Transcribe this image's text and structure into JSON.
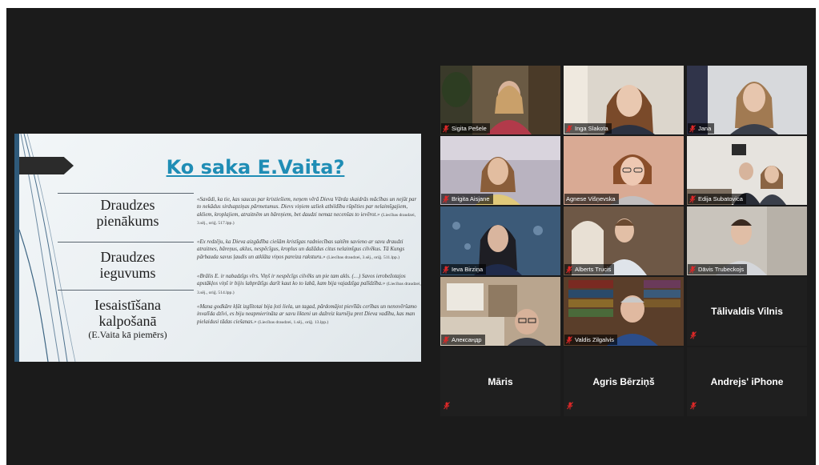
{
  "slide": {
    "title": "Ko saka E.Vaita?",
    "terms": [
      {
        "line1": "Draudzes",
        "line2": "pienākums"
      },
      {
        "line1": "Draudzes",
        "line2": "ieguvums"
      },
      {
        "line1": "Iesaistīšana",
        "line2": "kalpošanā",
        "note": "(E.Vaita kā piemērs)"
      }
    ],
    "quotes": [
      {
        "text": "«Savādi, ka tie, kas saucas par kristiešiem, neņem vērā Dieva Vārda skaidrās mācības un nejūt par to nekādus sirdsapziņas pārmetumus. Dievs viņiem uzliek atbildību rūpēties par nelaimīgajiem, akliem, kroplajiem, atraitnēm un bāreņiem, bet daudzi nemaz necenšas to ievērot.»",
        "source": "(Liecības draudzei, 3.sēj., oriģ. 517.lpp.)"
      },
      {
        "text": "«Ex redzēju, ka Dieva aizgādība ciešām kristīgas radniecības saitēm savieno ar savu draudzi atraitnes, bāreņus, aklus, nespēcīgus, kroplus un dažādus citus nelaimīgus cilvēkus. Tā Kungs pārbauda savus ļaudis un atklāta viņos pareiza raksturu.»",
        "source": "(Liecības draudzei, 3.sēj., oriģ. 511.lpp.)"
      },
      {
        "text": "«Brālis E. ir nabadzīgs vīrs. Viņš ir nespēcīgs cilvēks un pie tam akls. (…) Savos ierobežotajos apstākļos viņš ir bijis labprātīgs darīt kaut ko to labā, kam bija vajadzīga palīdzība.»",
        "source": "(Liecības draudzei, 3.sēj., oriģ. 514.lpp.)"
      },
      {
        "text": "«Mana godkāre kļūt izglītotai bija ļoti liela, un tagad, pārdomājot pievīlās cerības un nenovēršamo invalīda dzīvi, es biju neapmierināta ar savu likteni un dažreiz kurnēju pret Dieva vadību, kas man pielaidusi tādas ciešanas.»",
        "source": "(Liecības draudzei, 1.sēj., oriģ. 13.lpp.)"
      }
    ]
  },
  "participants": [
    {
      "name": "Sigita Pešele",
      "video": true,
      "muted": true
    },
    {
      "name": "Inga Slakota",
      "video": true,
      "muted": true
    },
    {
      "name": "Jana",
      "video": true,
      "muted": true
    },
    {
      "name": "Brigita Aisjane",
      "video": true,
      "muted": true
    },
    {
      "name": "Agnese Višņevska",
      "video": true,
      "muted": false,
      "active": true
    },
    {
      "name": "Edija Subatovica",
      "video": true,
      "muted": true
    },
    {
      "name": "Ieva Birziņa",
      "video": true,
      "muted": true
    },
    {
      "name": "Alberts Trucis",
      "video": true,
      "muted": true
    },
    {
      "name": "Dāvis Trubeckojs",
      "video": true,
      "muted": true
    },
    {
      "name": "Александр",
      "video": true,
      "muted": true
    },
    {
      "name": "Valdis Zilgalvis",
      "video": true,
      "muted": true
    },
    {
      "name": "Tālivaldis Vilnis",
      "video": false,
      "muted": true
    },
    {
      "name": "Māris",
      "video": false,
      "muted": true
    },
    {
      "name": "Agris Bērziņš",
      "video": false,
      "muted": true
    },
    {
      "name": "Andrejs' iPhone",
      "video": false,
      "muted": true
    }
  ],
  "colors": {
    "background": "#1b1b1b",
    "muted_icon": "#e02828",
    "active_speaker": "#c8e04a",
    "slide_title": "#1f8db5"
  }
}
